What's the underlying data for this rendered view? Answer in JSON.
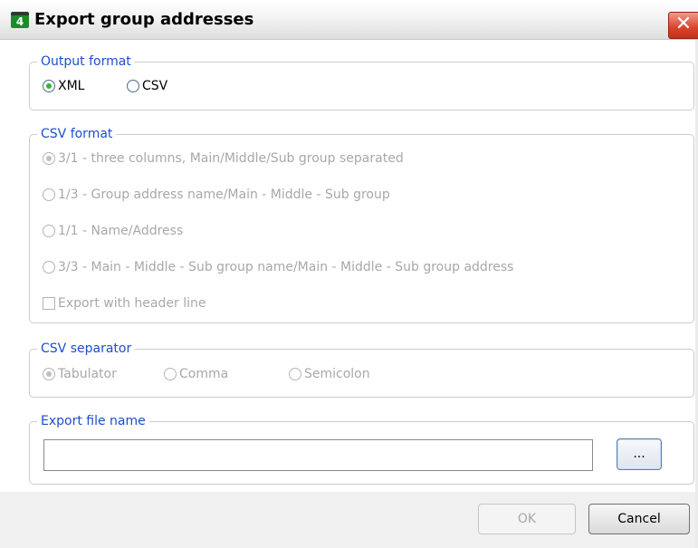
{
  "window": {
    "title": "Export group addresses",
    "icon": "ets-app-icon",
    "icon_glyph": "4",
    "close_glyph": "✕"
  },
  "output_format": {
    "legend": "Output format",
    "options": [
      {
        "label": "XML",
        "selected": true
      },
      {
        "label": "CSV",
        "selected": false
      }
    ]
  },
  "csv_format": {
    "legend": "CSV format",
    "enabled": false,
    "options": [
      {
        "label": "3/1 - three columns, Main/Middle/Sub group separated",
        "selected": true
      },
      {
        "label": "1/3 - Group address name/Main - Middle - Sub group",
        "selected": false
      },
      {
        "label": "1/1 - Name/Address",
        "selected": false
      },
      {
        "label": "3/3 - Main - Middle - Sub group name/Main - Middle - Sub group address",
        "selected": false
      }
    ],
    "header_checkbox": {
      "label": "Export with header line",
      "checked": false
    }
  },
  "csv_separator": {
    "legend": "CSV separator",
    "enabled": false,
    "options": [
      {
        "label": "Tabulator",
        "selected": true
      },
      {
        "label": "Comma",
        "selected": false
      },
      {
        "label": "Semicolon",
        "selected": false
      }
    ]
  },
  "export_file": {
    "legend": "Export file name",
    "value": "",
    "placeholder": "",
    "browse_label": "..."
  },
  "footer": {
    "ok_label": "OK",
    "ok_enabled": false,
    "cancel_label": "Cancel"
  },
  "colors": {
    "legend_text": "#1a4ecf",
    "disabled_text": "#a8a8a8",
    "radio_checked": "#37b237",
    "close_button": "#d9432c"
  }
}
